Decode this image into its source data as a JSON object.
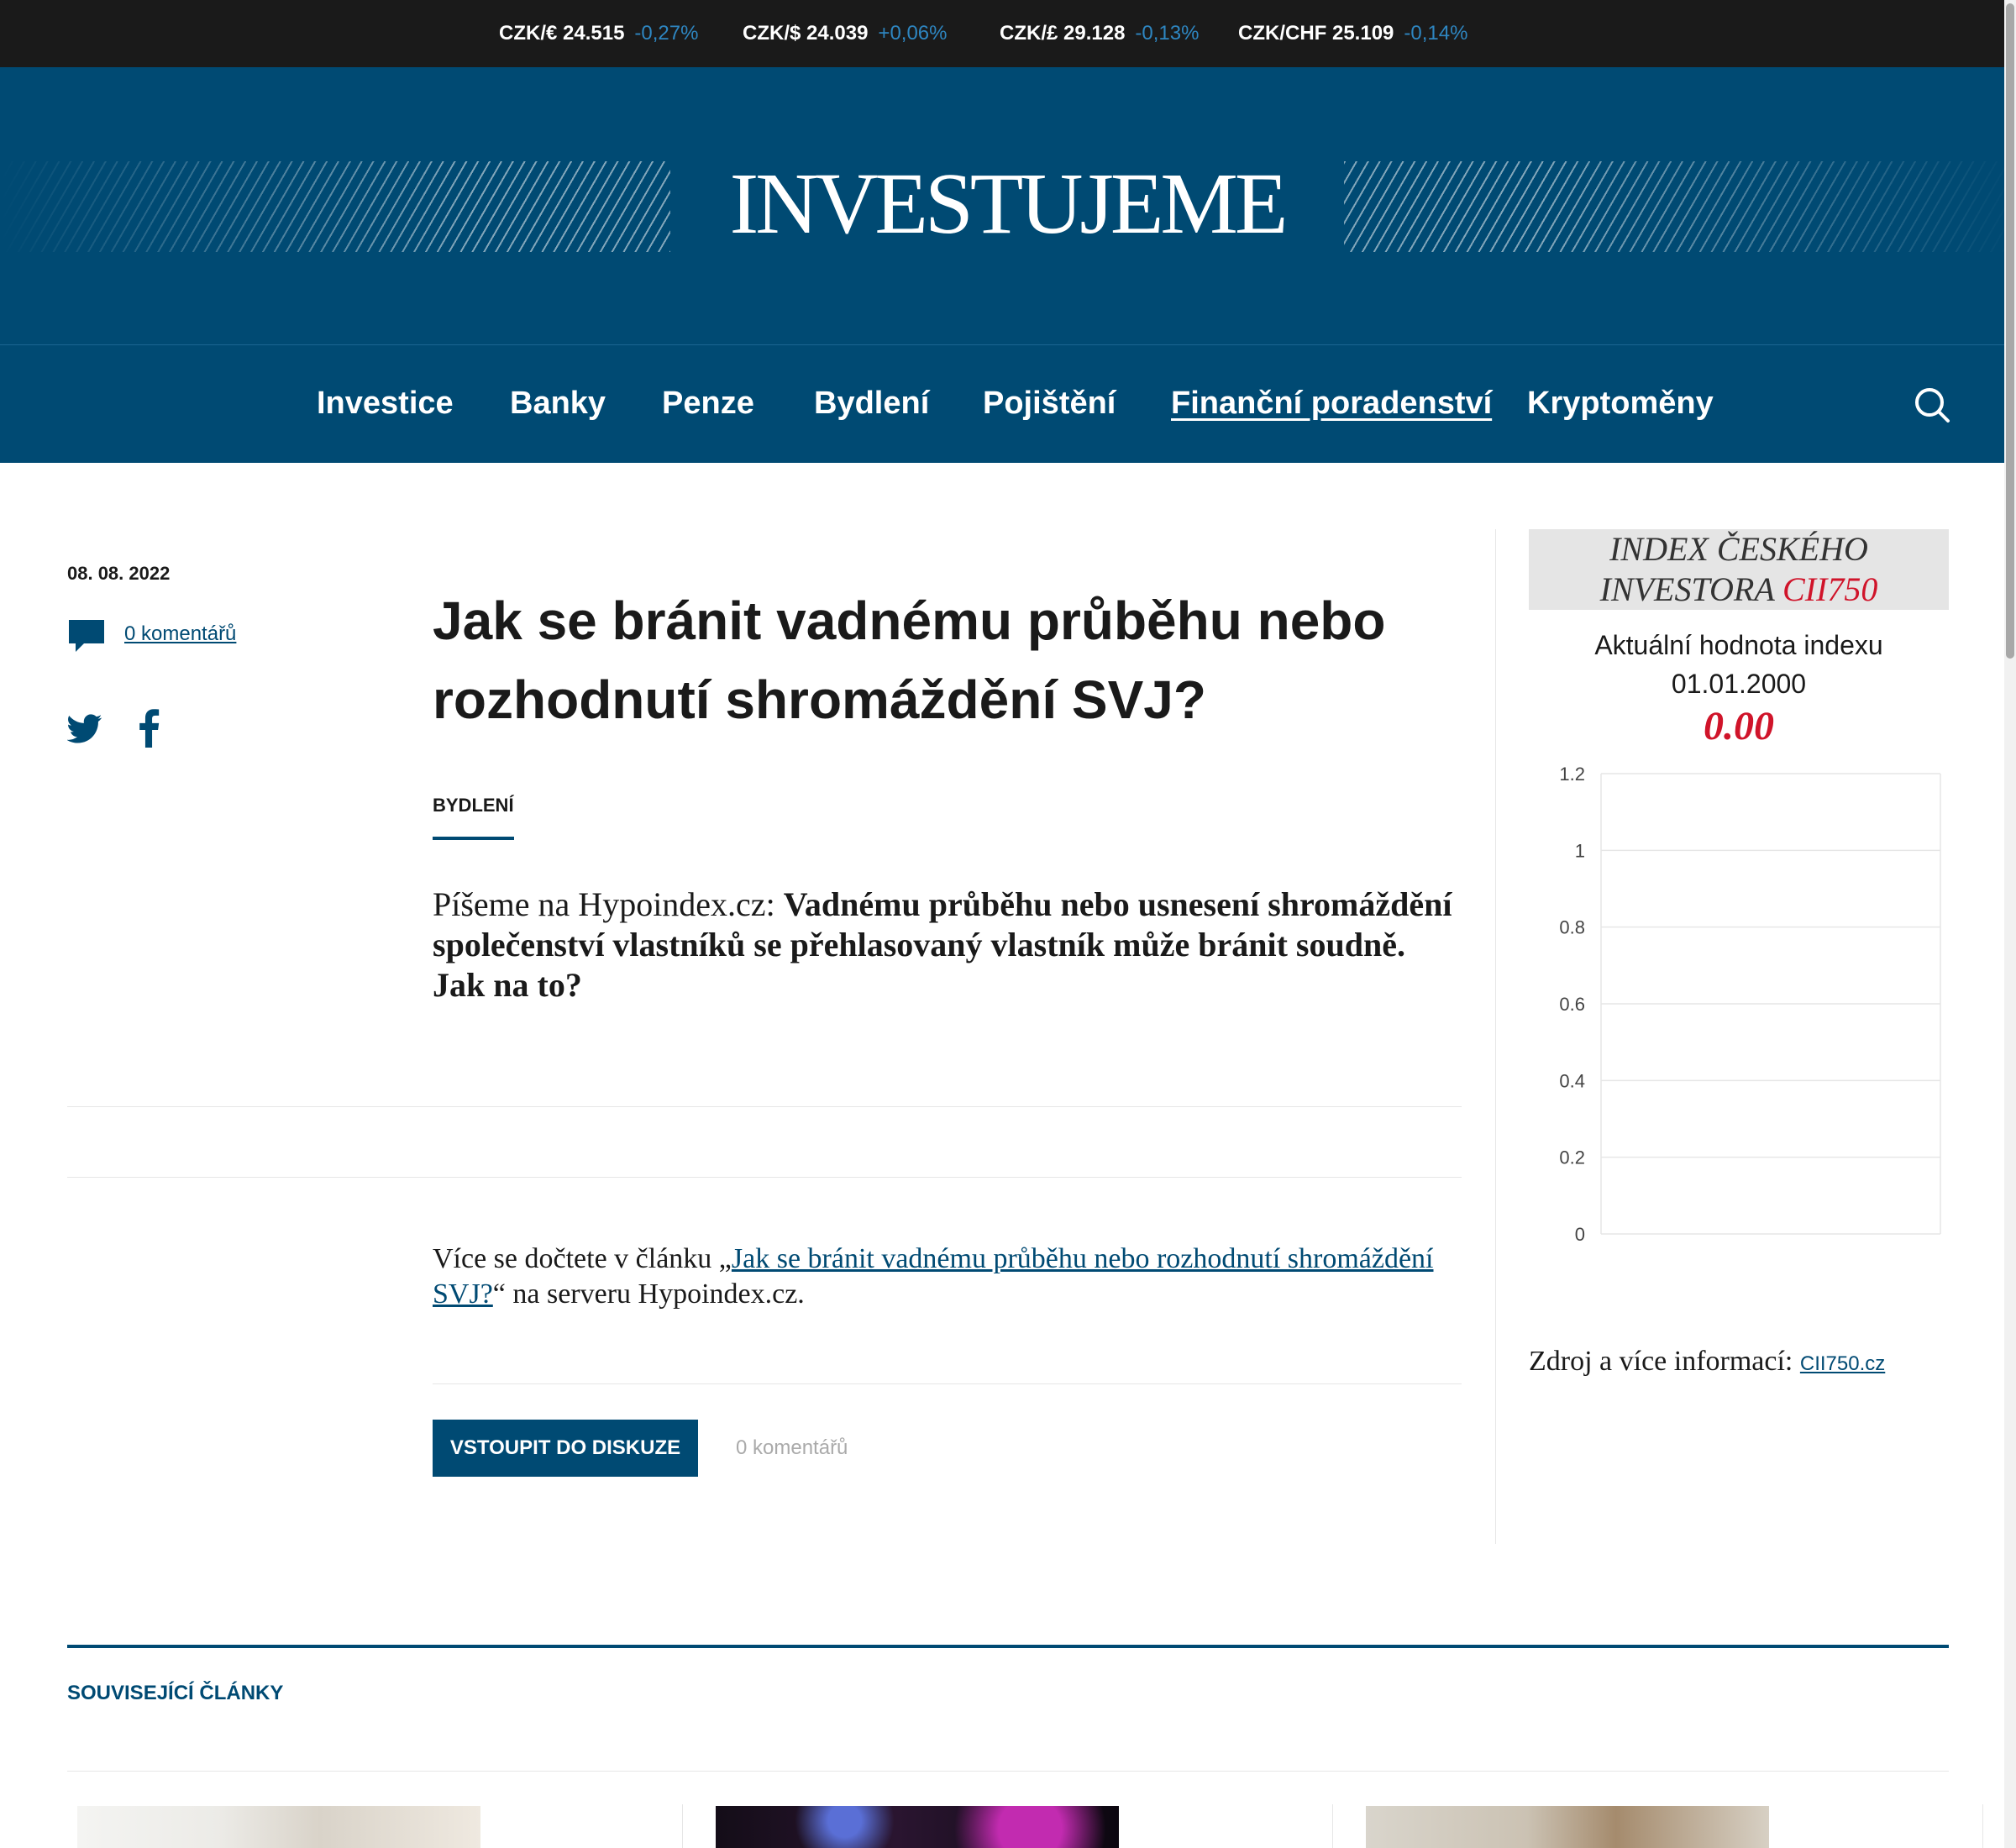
{
  "ticker": [
    {
      "pair": "CZK/€ 24.515",
      "change": "-0,27%"
    },
    {
      "pair": "CZK/$ 24.039",
      "change": "+0,06%"
    },
    {
      "pair": "CZK/£ 29.128",
      "change": "-0,13%"
    },
    {
      "pair": "CZK/CHF 25.109",
      "change": "-0,14%"
    }
  ],
  "header": {
    "logo": "INVESTUJEME"
  },
  "nav": {
    "items": [
      "Investice",
      "Banky",
      "Penze",
      "Bydlení",
      "Pojištění",
      "Finanční poradenství",
      "Kryptoměny"
    ],
    "active": "Finanční poradenství"
  },
  "article": {
    "date": "08. 08. 2022",
    "comments_link": "0 komentářů",
    "title": "Jak se bránit vadnému průběhu nebo rozhodnutí shromáždění SVJ?",
    "category": "BYDLENÍ",
    "perex_intro": "Píšeme na Hypoindex.cz: ",
    "perex_bold": "Vadnému průběhu nebo usnesení shromáždění společenství vlastníků se přehlasovaný vlastník může bránit soudně. Jak na to?",
    "more_prefix": "Více se dočtete v článku „",
    "more_link": "Jak se bránit vadnému průběhu nebo rozhodnutí shromáždění SVJ?",
    "more_suffix": "“ na serveru Hypoindex.cz.",
    "discuss_button": "VSTOUPIT DO DISKUZE",
    "discuss_count": "0 komentářů"
  },
  "sidebar": {
    "title_line1": "INDEX ČESKÉHO",
    "title_line2": "INVESTORA ",
    "title_accent": "CII750",
    "label": "Aktuální hodnota indexu",
    "date": "01.01.2000",
    "value": "0.00",
    "source_label": "Zdroj a více informací: ",
    "source_link": "CII750.cz"
  },
  "chart_data": {
    "type": "line",
    "yticks": [
      "1.2",
      "1",
      "0.8",
      "0.6",
      "0.4",
      "0.2",
      "0"
    ],
    "ylim": [
      0,
      1.2
    ],
    "grid": true,
    "series": []
  },
  "related": {
    "title": "SOUVISEJÍCÍ ČLÁNKY"
  },
  "colors": {
    "brand": "#004a73",
    "ticker_bg": "#1a1a1a",
    "change": "#2e86c1",
    "accent_red": "#d0142a"
  },
  "icons": [
    "search-icon",
    "comment-icon",
    "twitter-icon",
    "facebook-icon"
  ]
}
